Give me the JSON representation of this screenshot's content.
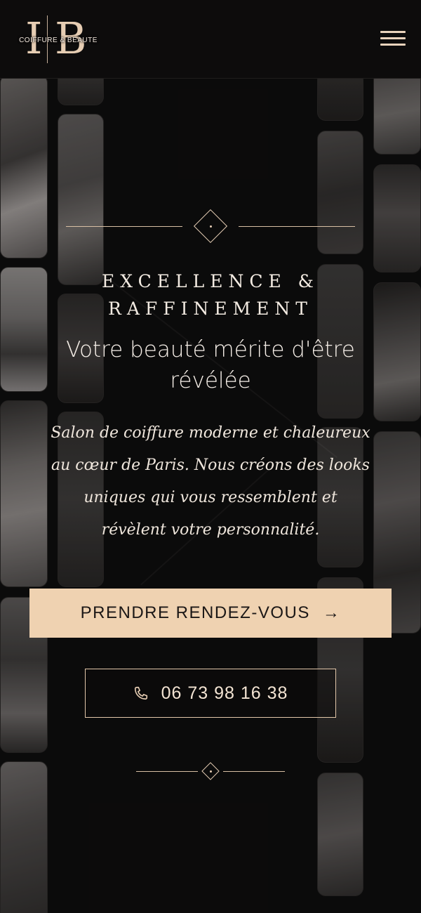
{
  "header": {
    "logo_letters": [
      "I",
      "B"
    ],
    "logo_tagline": "COIFFURE & BEAUTE",
    "menu_icon": "hamburger-menu-icon"
  },
  "hero": {
    "eyebrow_line1": "EXCELLENCE &",
    "eyebrow_line2": "RAFFINEMENT",
    "title": "Votre beauté mérite d'être révélée",
    "description": "Salon de coiffure moderne et chaleureux au cœur de Paris. Nous créons des looks uniques qui vous ressemblent et révèlent votre personnalité.",
    "cta_label": "PRENDRE RENDEZ-VOUS",
    "cta_icon": "arrow-right-icon",
    "phone_number": "06 73 98 16 38",
    "phone_icon": "phone-icon"
  },
  "colors": {
    "background": "#0c0b0b",
    "accent": "#efd2b1",
    "gold_line": "#d8bfa4",
    "text": "#f3ebe2"
  }
}
